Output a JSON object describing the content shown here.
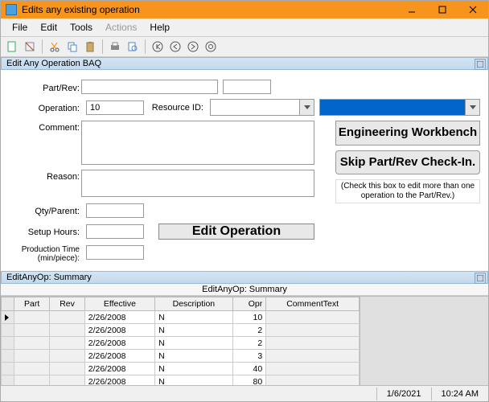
{
  "window": {
    "title": "Edits any existing operation"
  },
  "menu": {
    "file": "File",
    "edit": "Edit",
    "tools": "Tools",
    "actions": "Actions",
    "help": "Help"
  },
  "toolbar_icons": {
    "new": "new-icon",
    "save": "save-icon",
    "cut": "cut-icon",
    "copy": "copy-icon",
    "paste": "paste-icon",
    "print": "print-icon",
    "preview": "preview-icon",
    "sep": "",
    "first": "first-icon",
    "back": "back-icon",
    "forward": "forward-icon",
    "last": "last-icon"
  },
  "section": {
    "edit_any_op_baq": "Edit Any Operation BAQ"
  },
  "form": {
    "labels": {
      "part_rev": "Part/Rev:",
      "operation": "Operation:",
      "resource_id": "Resource ID:",
      "comment": "Comment:",
      "reason": "Reason:",
      "qty_parent": "Qty/Parent:",
      "setup_hours": "Setup Hours:",
      "prod_time": "Production Time (min/piece):"
    },
    "values": {
      "part": "",
      "rev": "",
      "operation": "10",
      "resource_id": "",
      "resource_extra": "",
      "comment": "",
      "reason": "",
      "qty_parent": "",
      "setup_hours": "",
      "prod_time": ""
    },
    "buttons": {
      "edit_operation": "Edit Operation",
      "eng_workbench": "Engineering Workbench",
      "skip_checkin": "Skip Part/Rev Check-In."
    },
    "hint": "(Check this box to edit more than one operation to the Part/Rev.)"
  },
  "summary": {
    "bar": "EditAnyOp: Summary",
    "title": "EditAnyOp: Summary",
    "columns": {
      "part": "Part",
      "rev": "Rev",
      "effective": "Effective",
      "description": "Description",
      "opr": "Opr",
      "comment_text": "CommentText"
    },
    "rows": [
      {
        "effective": "2/26/2008",
        "description": "N",
        "opr": "10"
      },
      {
        "effective": "2/26/2008",
        "description": "N",
        "opr": "2"
      },
      {
        "effective": "2/26/2008",
        "description": "N",
        "opr": "2"
      },
      {
        "effective": "2/26/2008",
        "description": "N",
        "opr": "3"
      },
      {
        "effective": "2/26/2008",
        "description": "N",
        "opr": "40"
      },
      {
        "effective": "2/26/2008",
        "description": "N",
        "opr": "80"
      }
    ]
  },
  "status": {
    "date": "1/6/2021",
    "time": "10:24 AM"
  }
}
